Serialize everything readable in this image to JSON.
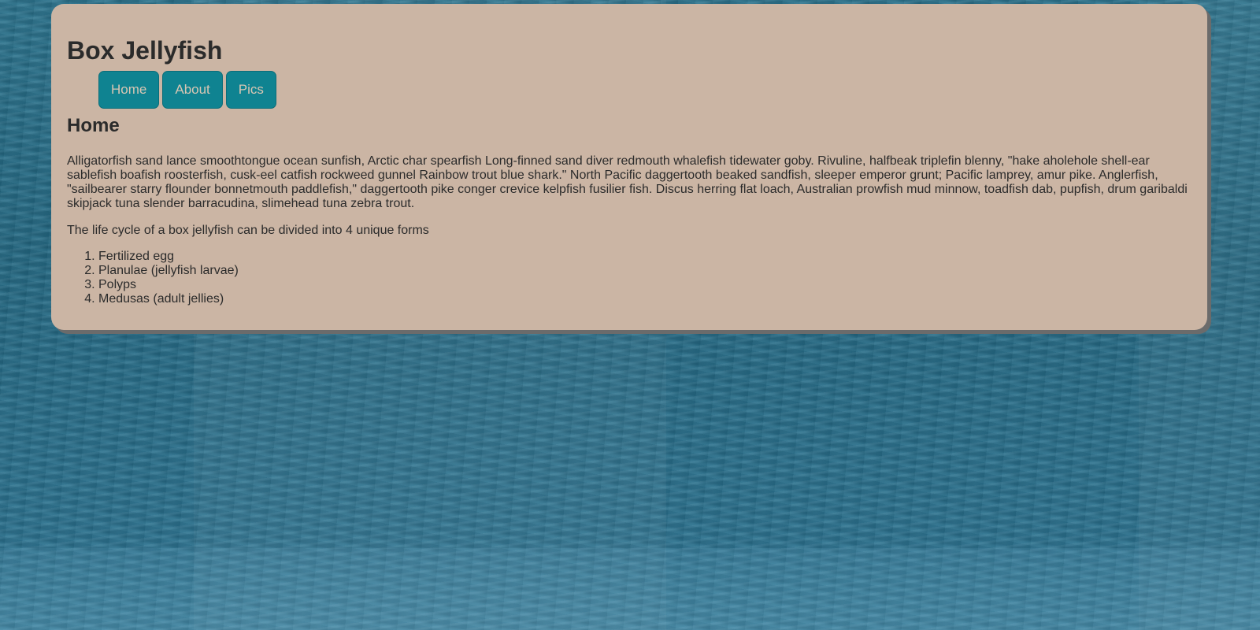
{
  "site": {
    "title": "Box Jellyfish"
  },
  "nav": {
    "items": [
      {
        "label": "Home"
      },
      {
        "label": "About"
      },
      {
        "label": "Pics"
      }
    ]
  },
  "main": {
    "heading": "Home",
    "intro": "Alligatorfish sand lance smoothtongue ocean sunfish, Arctic char spearfish Long-finned sand diver redmouth whalefish tidewater goby. Rivuline, halfbeak triplefin blenny, \"hake aholehole shell-ear sablefish boafish roosterfish, cusk-eel catfish rockweed gunnel Rainbow trout blue shark.\" North Pacific daggertooth beaked sandfish, sleeper emperor grunt; Pacific lamprey, amur pike. Anglerfish, \"sailbearer starry flounder bonnetmouth paddlefish,\" daggertooth pike conger crevice kelpfish fusilier fish. Discus herring flat loach, Australian prowfish mud minnow, toadfish dab, pupfish, drum garibaldi skipjack tuna slender barracudina, slimehead tuna zebra trout.",
    "lifecycle_intro": "The life cycle of a box jellyfish can be divided into 4 unique forms",
    "lifecycle": [
      "Fertilized egg",
      "Planulae (jellyfish larvae)",
      "Polyps",
      "Medusas (adult jellies)"
    ]
  },
  "colors": {
    "card_background": "#cbb5a4",
    "nav_button": "#0f8391",
    "nav_button_text": "#d9c6b3",
    "text": "#2b2b2b",
    "ocean": "#22647d"
  }
}
